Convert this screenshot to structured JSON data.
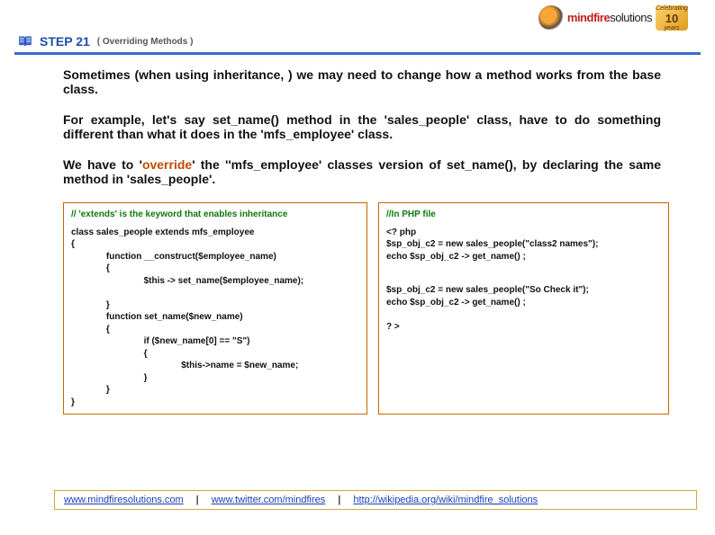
{
  "branding": {
    "name_primary": "mindfire",
    "name_secondary": "solutions",
    "tagline_top": "Celebrating",
    "years": "10",
    "tagline_bottom": "years"
  },
  "step": {
    "label": "STEP 21",
    "subtitle": "( Overriding  Methods  )"
  },
  "body": {
    "para1": "Sometimes (when using inheritance, ) we may need to change how a method works from the base class.",
    "para2": "For example, let's say set_name() method in the 'sales_people' class, have to do something different than what it does in the 'mfs_employee' class.",
    "para3_pre": "We have to  '",
    "para3_highlight": "override",
    "para3_post": "' the ''mfs_employee' classes version of set_name(), by declaring the same method in 'sales_people'."
  },
  "code": {
    "left_comment": "// 'extends' is the keyword that enables inheritance",
    "left_body": "class sales_people extends mfs_employee\n{ \n              function __construct($employee_name)\n              {\n                             $this -> set_name($employee_name);\n\n              }\n              function set_name($new_name)\n              { \n                             if ($new_name[0] == \"S\")\n                             {\n                                            $this->name = $new_name;\n                             }\n              }\n}",
    "right_comment": "//In PHP file",
    "right_body1": "<? php\n$sp_obj_c2 = new sales_people(\"class2 names\");\necho $sp_obj_c2 -> get_name() ;",
    "right_body2": "$sp_obj_c2 = new sales_people(\"So Check it\");\necho $sp_obj_c2 -> get_name() ;",
    "right_body3": "? >"
  },
  "footer": {
    "link1": "www.mindfiresolutions.com",
    "link2": "www.twitter.com/mindfires",
    "link3": "http://wikipedia.org/wiki/mindfire_solutions",
    "sep": "|"
  }
}
